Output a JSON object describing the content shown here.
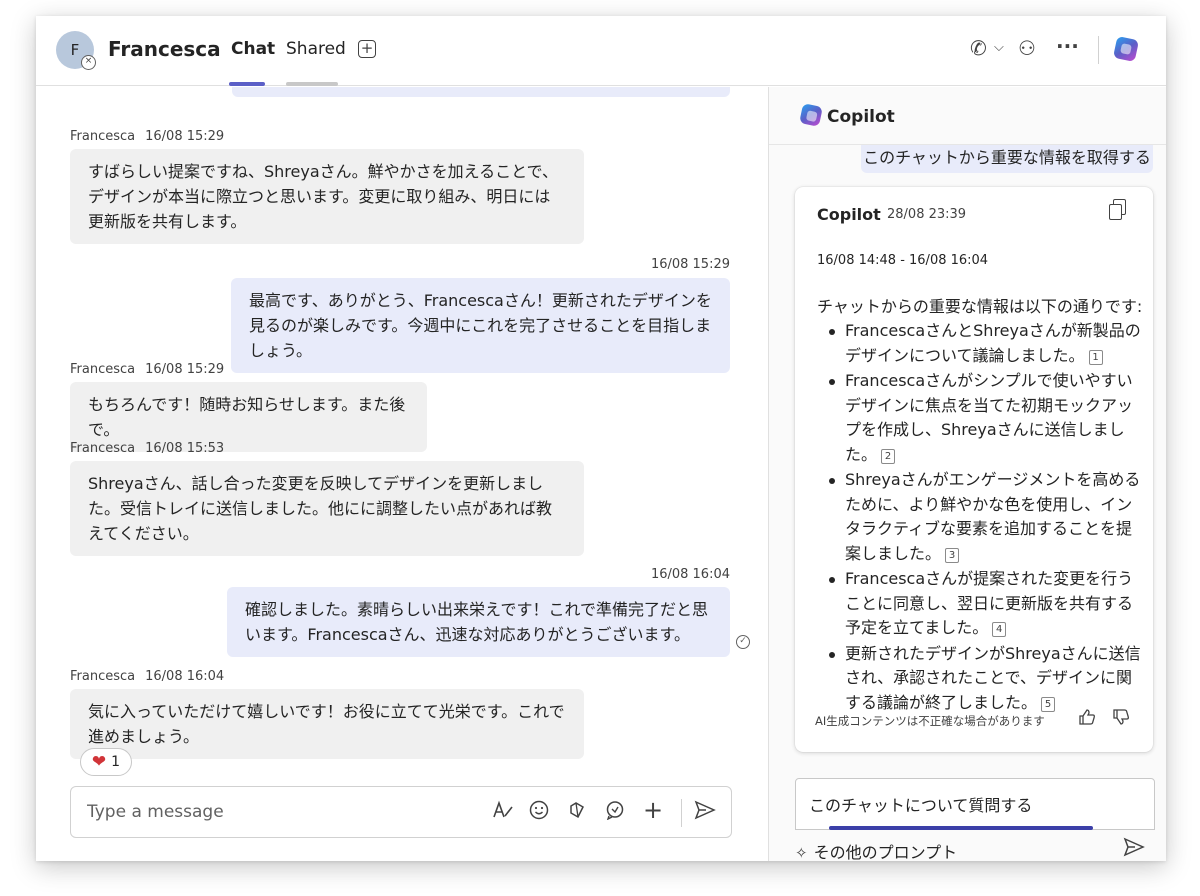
{
  "header": {
    "avatar_initial": "F",
    "name": "Francesca",
    "tabs": [
      {
        "label": "Chat"
      },
      {
        "label": "Shared"
      }
    ],
    "add_tab": "+",
    "call_icon": "✆",
    "chevron": "⌵",
    "people_icon": "⚇",
    "more": "···"
  },
  "messages": [
    {
      "sender": "Francesca",
      "time": "16/08 15:29",
      "text": "すばらしい提案ですね、Shreyaさん。鮮やかさを加えることで、デザインが本当に際立つと思います。変更に取り組み、明日には更新版を共有します。"
    },
    {
      "sender": "",
      "time": "16/08 15:29",
      "text": "最高です、ありがとう、Francescaさん！更新されたデザインを見るのが楽しみです。今週中にこれを完了させることを目指しましょう。"
    },
    {
      "sender": "Francesca",
      "time": "16/08 15:29",
      "text": "もちろんです！随時お知らせします。また後で。"
    },
    {
      "sender": "Francesca",
      "time": "16/08 15:53",
      "text": "Shreyaさん、話し合った変更を反映してデザインを更新しました。受信トレイに送信しました。他にに調整したい点があれば教えてください。"
    },
    {
      "sender": "",
      "time": "16/08 16:04",
      "text": "確認しました。素晴らしい出来栄えです！これで準備完了だと思います。Francescaさん、迅速な対応ありがとうございます。"
    },
    {
      "sender": "Francesca",
      "time": "16/08 16:04",
      "text": "気に入っていただけて嬉しいです！お役に立てて光栄です。これで進めましょう。"
    }
  ],
  "reaction": {
    "emoji": "❤",
    "count": "1"
  },
  "composer": {
    "placeholder": "Type a message"
  },
  "copilot": {
    "title": "Copilot",
    "user_prompt": "このチャットから重要な情報を取得する",
    "card": {
      "sender": "Copilot",
      "time": "28/08 23:39",
      "range": "16/08 14:48 - 16/08 16:04",
      "intro": "チャットからの重要な情報は以下の通りです:",
      "bullets": [
        {
          "text": "FrancescaさんとShreyaさんが新製品のデザインについて議論しました。",
          "cite": "1"
        },
        {
          "text": "Francescaさんがシンプルで使いやすいデザインに焦点を当てた初期モックアップを作成し、Shreyaさんに送信しました。",
          "cite": "2"
        },
        {
          "text": "Shreyaさんがエンゲージメントを高めるために、より鮮やかな色を使用し、インタラクティブな要素を追加することを提案しました。",
          "cite": "3"
        },
        {
          "text": "Francescaさんが提案された変更を行うことに同意し、翌日に更新版を共有する予定を立てました。",
          "cite": "4"
        },
        {
          "text": "更新されたデザインがShreyaさんに送信され、承認されたことで、デザインに関する議論が終了しました。",
          "cite": "5"
        }
      ],
      "disclaimer": "AI生成コンテンツは不正確な場合があります"
    },
    "input_value": "このチャットについて質問する",
    "more_prompts": "その他のプロンプト"
  }
}
